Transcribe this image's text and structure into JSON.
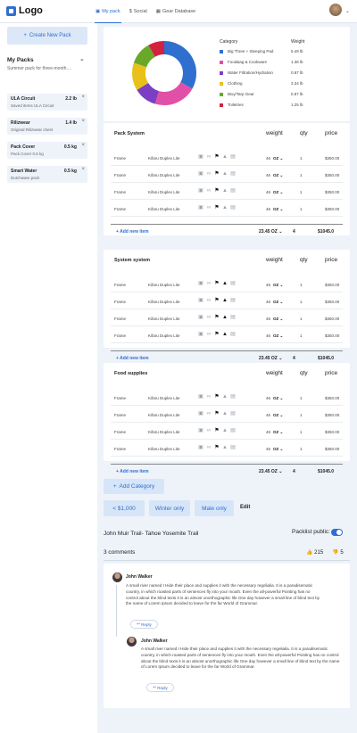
{
  "header": {
    "logo": "Logo",
    "tabs": [
      {
        "label": "My pack",
        "icon": "backpack-icon",
        "active": true
      },
      {
        "label": "Social",
        "icon": "dollar-icon",
        "active": false
      },
      {
        "label": "Gear Database",
        "icon": "grid-icon",
        "active": false
      }
    ]
  },
  "sidebar": {
    "new_pack": "Create New Pack",
    "my_packs_title": "My Packs",
    "my_packs_desc": "Summer pack for three-month....",
    "items": [
      {
        "name": "ULA Circuit",
        "weight": "2.2 lb",
        "desc": "Saved items ULA Circuit"
      },
      {
        "name": "Rilizwear",
        "weight": "1.4 lb",
        "desc": "Original Rilizwear chest"
      },
      {
        "name": "Pack Cover",
        "weight": "0.5 kg",
        "desc": "Pack Cover 0.5 kg"
      },
      {
        "name": "Smart Water",
        "weight": "0.5 kg",
        "desc": "Dutchware pack"
      }
    ]
  },
  "summary": {
    "category_header": "Category",
    "weight_header": "Weight",
    "legend": [
      {
        "label": "Big Three + Sleeping Pad",
        "value": "5.49 lb",
        "color": "#2f6fd0",
        "fraction": 0.284
      },
      {
        "label": "Food&ag & Cookware",
        "value": "1.36 lb",
        "color": "#e24fa6",
        "fraction": 0.185
      },
      {
        "label": "Water Filtration/Hydration",
        "value": "0.97 lb",
        "color": "#7b3fc4",
        "fraction": 0.1
      },
      {
        "label": "Clothing",
        "value": "3.34 lb",
        "color": "#e8c21a",
        "fraction": 0.12
      },
      {
        "label": "Bivy/Tarp Gear",
        "value": "0.87 lb",
        "color": "#6aa82a",
        "fraction": 0.1
      },
      {
        "label": "Toiletries",
        "value": "1.25 lb",
        "color": "#d3213f",
        "fraction": 0.07
      }
    ]
  },
  "columns": {
    "weight": "weight",
    "qty": "qty",
    "price": "price"
  },
  "sections": [
    {
      "title": "Pack System",
      "rows": [
        {
          "name": "Frame",
          "brand": "Kifaru Duplex Lite",
          "weight": "46",
          "unit": "OZ",
          "qty": "1",
          "price": "$350.00"
        },
        {
          "name": "Frame",
          "brand": "Kifaru Duplex Lite",
          "weight": "46",
          "unit": "OZ",
          "qty": "1",
          "price": "$350.00"
        },
        {
          "name": "Frame",
          "brand": "Kifaru Duplex Lite",
          "weight": "46",
          "unit": "OZ",
          "qty": "1",
          "price": "$350.00"
        },
        {
          "name": "Frame",
          "brand": "Kifaru Duplex Lite",
          "weight": "46",
          "unit": "OZ",
          "qty": "1",
          "price": "$350.00"
        }
      ],
      "add_item": "Add new item",
      "total_weight": "23.45",
      "total_unit": "OZ",
      "total_qty": "4",
      "total_price": "$1045.0"
    },
    {
      "title": "System system",
      "rows": [
        {
          "name": "Frame",
          "brand": "Kifaru Duplex Lite",
          "weight": "46",
          "unit": "OZ",
          "qty": "1",
          "price": "$350.00"
        },
        {
          "name": "Frame",
          "brand": "Kifaru Duplex Lite",
          "weight": "46",
          "unit": "OZ",
          "qty": "1",
          "price": "$350.00"
        },
        {
          "name": "Frame",
          "brand": "Kifaru Duplex Lite",
          "weight": "46",
          "unit": "OZ",
          "qty": "1",
          "price": "$350.00"
        },
        {
          "name": "Frame",
          "brand": "Kifaru Duplex Lite",
          "weight": "46",
          "unit": "OZ",
          "qty": "1",
          "price": "$350.00"
        }
      ],
      "add_item": "Add new item",
      "total_weight": "23.45",
      "total_unit": "OZ",
      "total_qty": "4",
      "total_price": "$1045.0"
    },
    {
      "title": "Food supplies",
      "rows": [
        {
          "name": "Frame",
          "brand": "Kifaru Duplex Lite",
          "weight": "46",
          "unit": "OZ",
          "qty": "1",
          "price": "$350.00"
        },
        {
          "name": "Frame",
          "brand": "Kifaru Duplex Lite",
          "weight": "46",
          "unit": "OZ",
          "qty": "1",
          "price": "$350.00"
        },
        {
          "name": "Frame",
          "brand": "Kifaru Duplex Lite",
          "weight": "46",
          "unit": "OZ",
          "qty": "1",
          "price": "$350.00"
        },
        {
          "name": "Frame",
          "brand": "Kifaru Duplex Lite",
          "weight": "46",
          "unit": "OZ",
          "qty": "1",
          "price": "$350.00"
        }
      ],
      "add_item": "Add new item",
      "total_weight": "23.45",
      "total_unit": "OZ",
      "total_qty": "4",
      "total_price": "$1045.0"
    }
  ],
  "add_category": "Add Category",
  "filters": [
    "< $1,000",
    "Winter only",
    "Male only"
  ],
  "edit": "Edit",
  "trail": "John Muir Trail- Tahoe Yosemite Trail",
  "packlist_public": "Packlist public:",
  "comments_count": "3 comments",
  "likes": "215",
  "dislikes": "5",
  "comments": [
    {
      "author": "John Walker",
      "text": "A small river named I Hide their place and supplies it with the necessary regelialia. It is a paradisematic country, in which roasted parts of sentences fly into your mouth. Even the all-powerful Pointing has no control about the blind texts it is an almost unorthographic life One day however a small line of blind text by the name of Lorem Ipsum decided to leave for the far World of Grammar.",
      "reply": "Reply"
    },
    {
      "author": "John Walker",
      "text": "A small river named I Hide their place and supplies it with the necessary regelialia. It is a paradisematic country, in which roasted parts of sentences fly into your mouth. Even the all-powerful Pointing has no control about the blind texts it is an almost unorthographic life One day however a small line of blind text by the name of Lorem Ipsum decided to leave for the far World of Grammar.",
      "reply": "Reply"
    }
  ]
}
